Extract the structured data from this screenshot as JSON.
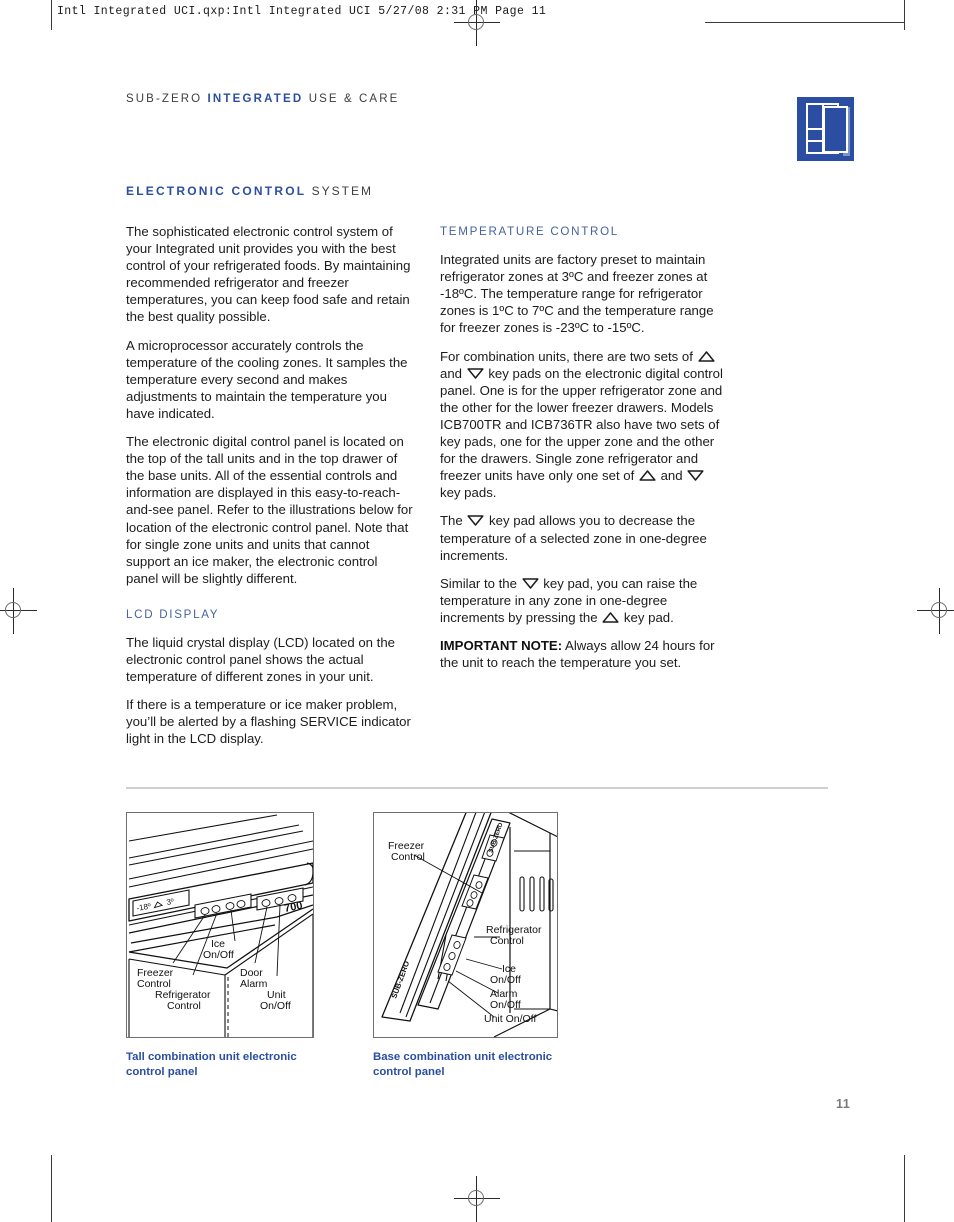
{
  "prepress": {
    "header_line": "Intl Integrated UCI.qxp:Intl Integrated UCI   5/27/08   2:31 PM   Page 11"
  },
  "running_head": {
    "pre": "SUB-ZERO ",
    "brand": "INTEGRATED",
    "post": " USE & CARE"
  },
  "section": {
    "strong": "ELECTRONIC CONTROL",
    "rest": " SYSTEM"
  },
  "left_column": {
    "paragraph_1": "The sophisticated electronic control system of your Integrated unit provides you with the best control of your refrigerated foods. By maintaining recommended refrigerator and freezer temperatures, you can keep food safe and retain the best quality possible.",
    "paragraph_2": "A microprocessor accurately controls the temperature of the cooling zones. It samples the temperature every second and makes adjustments to maintain the temperature you have indicated.",
    "paragraph_3": "The electronic digital control panel is located on the top of the tall units and in the top drawer of the base units. All of the essential controls and information are displayed in this easy-to-reach-and-see panel. Refer to the illustrations below for location of the electronic control panel. Note that for single zone units and units that cannot support an ice maker, the electronic control panel will be slightly different.",
    "lcd_heading": "LCD DISPLAY",
    "lcd_paragraph_1": "The liquid crystal display (LCD) located on the electronic control panel shows the actual temperature of different zones in your unit.",
    "lcd_paragraph_2": "If there is a temperature or ice maker problem, you’ll be alerted by a flashing SERVICE indicator light in the LCD display."
  },
  "right_column": {
    "temp_heading": "TEMPERATURE CONTROL",
    "temp_paragraph_1": "Integrated units are factory preset to maintain refrigerator zones at 3ºC and freezer zones at -18ºC. The temperature range for refrigerator zones is 1ºC to 7ºC and the temperature range for freezer zones is -23ºC to -15ºC.",
    "combo_part_1": "For combination units, there are two sets of ",
    "combo_part_2": " and ",
    "combo_part_3": " key pads on the electronic digital control panel. One is for the upper refrigerator zone and the other for the lower freezer drawers. Models ICB700TR and ICB736TR also have two sets of key pads, one for the upper zone and the other for the drawers. Single zone refrigerator and freezer units have only one set of ",
    "combo_part_4": " and ",
    "combo_part_5": " key pads.",
    "down_part_1": "The ",
    "down_part_2": " key pad allows you to decrease the temperature of a selected zone in one-degree increments.",
    "up_part_1": "Similar to the ",
    "up_part_2": " key pad, you can raise the temperature in any zone in one-degree increments by pressing the ",
    "up_part_3": " key pad.",
    "note_label": "IMPORTANT NOTE:",
    "note_text": " Always allow 24 hours for the unit to reach the temperature you set."
  },
  "figures": {
    "tall": {
      "caption": "Tall combination unit electronic control panel",
      "brand_badge": "700",
      "lcd_left_value": "-18º",
      "lcd_right_value": "3º",
      "labels": {
        "ice_on_off": "Ice\nOn/Off",
        "freezer_control": "Freezer\nControl",
        "refrigerator_control": "Refrigerator\nControl",
        "door_alarm": "Door\nAlarm",
        "unit_on_off": "Unit\nOn/Off"
      }
    },
    "base": {
      "caption": "Base combination unit electronic control panel",
      "labels": {
        "freezer_control": "Freezer\nControl",
        "refrigerator_control": "Refrigerator\nControl",
        "ice_on_off": "Ice\nOn/Off",
        "alarm_on_off": "Alarm\nOn/Off",
        "unit_on_off": "Unit On/Off"
      }
    }
  },
  "folio": {
    "page_number": "11"
  },
  "colors": {
    "brand_blue": "#2b4ea2",
    "subhead_blue": "#46639f",
    "body_text": "#1c1c1c",
    "rule_gray": "#cfcfcf",
    "folio_gray": "#7a7a7a"
  }
}
